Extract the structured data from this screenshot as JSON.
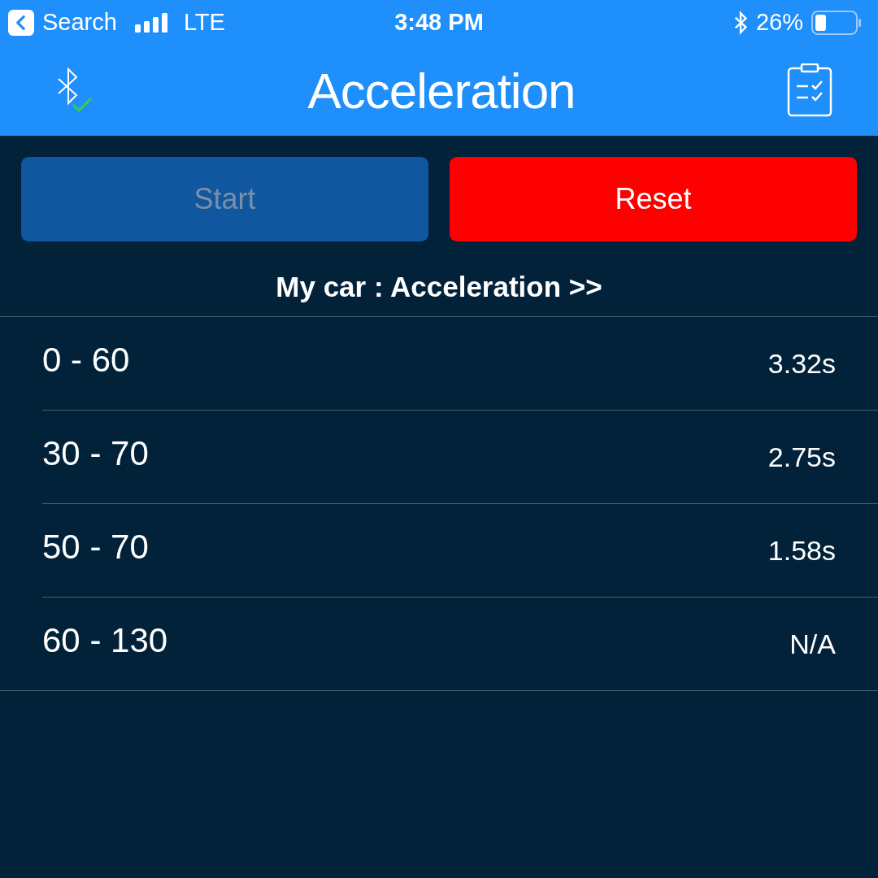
{
  "status_bar": {
    "back_label": "Search",
    "network": "LTE",
    "time": "3:48 PM",
    "battery": "26%"
  },
  "header": {
    "title": "Acceleration"
  },
  "buttons": [
    {
      "label": "Start",
      "kind": "start",
      "disabled": true
    },
    {
      "label": "Reset",
      "kind": "reset",
      "disabled": false
    }
  ],
  "section_title": "My car : Acceleration >>",
  "results": [
    {
      "range": "0 - 60",
      "time": "3.32s"
    },
    {
      "range": "30 - 70",
      "time": "2.75s"
    },
    {
      "range": "50 - 70",
      "time": "1.58s"
    },
    {
      "range": "60 - 130",
      "time": "N/A"
    }
  ]
}
